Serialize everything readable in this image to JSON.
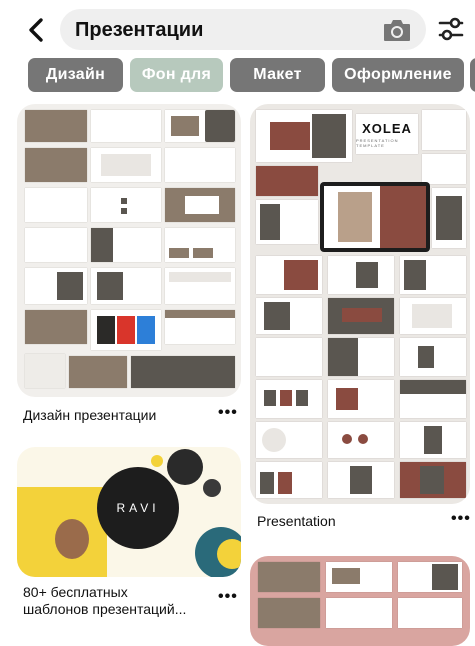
{
  "search": {
    "query": "Презентации"
  },
  "chips": [
    {
      "label": "Дизайн",
      "color": "#767676"
    },
    {
      "label": "Фон для",
      "color": "#b7c9bd"
    },
    {
      "label": "Макет",
      "color": "#767676"
    },
    {
      "label": "Оформление",
      "color": "#767676"
    }
  ],
  "pins": {
    "left_1": {
      "title": "Дизайн презентации"
    },
    "left_2": {
      "title_line1": "80+ бесплатных",
      "title_line2": "шаблонов презентаций..."
    },
    "right_1": {
      "title": "Presentation",
      "brand": "XOLEA",
      "brand_sub": "PRESENTATION TEMPLATE"
    },
    "ravi": {
      "logo": "RAVI"
    }
  },
  "more_glyph": "•••",
  "icons": [
    "chevron-left-icon",
    "camera-icon",
    "filter-sliders-icon",
    "more-icon"
  ]
}
